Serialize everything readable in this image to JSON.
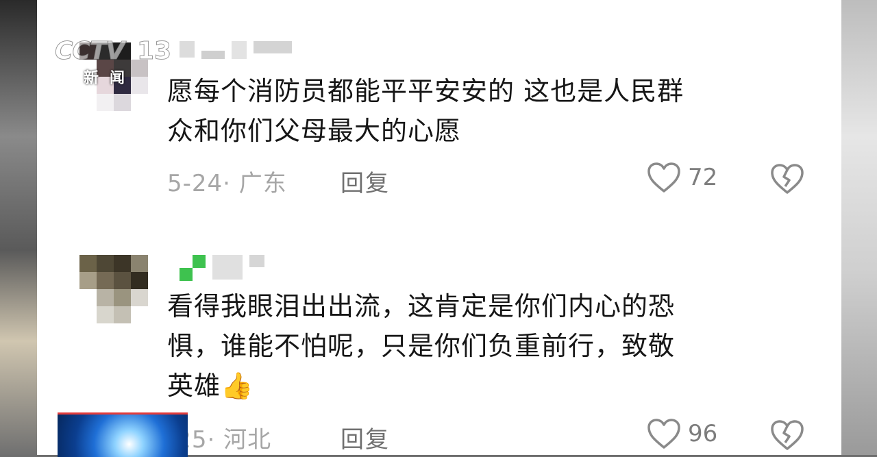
{
  "overlay": {
    "channel_logo": "CCTV",
    "channel_number": "13",
    "channel_sub": "新闻"
  },
  "comments": [
    {
      "text_line1": "愿每个消防员都能平平安安的 这也是人民群",
      "text_line2": "众和你们父母最大的心愿",
      "meta": "5-24· 广东",
      "reply_label": "回复",
      "like_count": "72"
    },
    {
      "text_line1": "看得我眼泪出出流，这肯定是你们内心的恐",
      "text_line2": "惧，谁能不怕呢，只是你们负重前行，致敬",
      "text_line3": "英雄👍",
      "meta": "-25· 河北",
      "reply_label": "回复",
      "like_count": "96"
    }
  ],
  "icons": {
    "like": "heart-outline-icon",
    "dislike": "broken-heart-icon"
  },
  "colors": {
    "text": "#161616",
    "meta": "#a6a6a6",
    "reply": "#6f6f6f",
    "icon": "#8a8a8a"
  }
}
